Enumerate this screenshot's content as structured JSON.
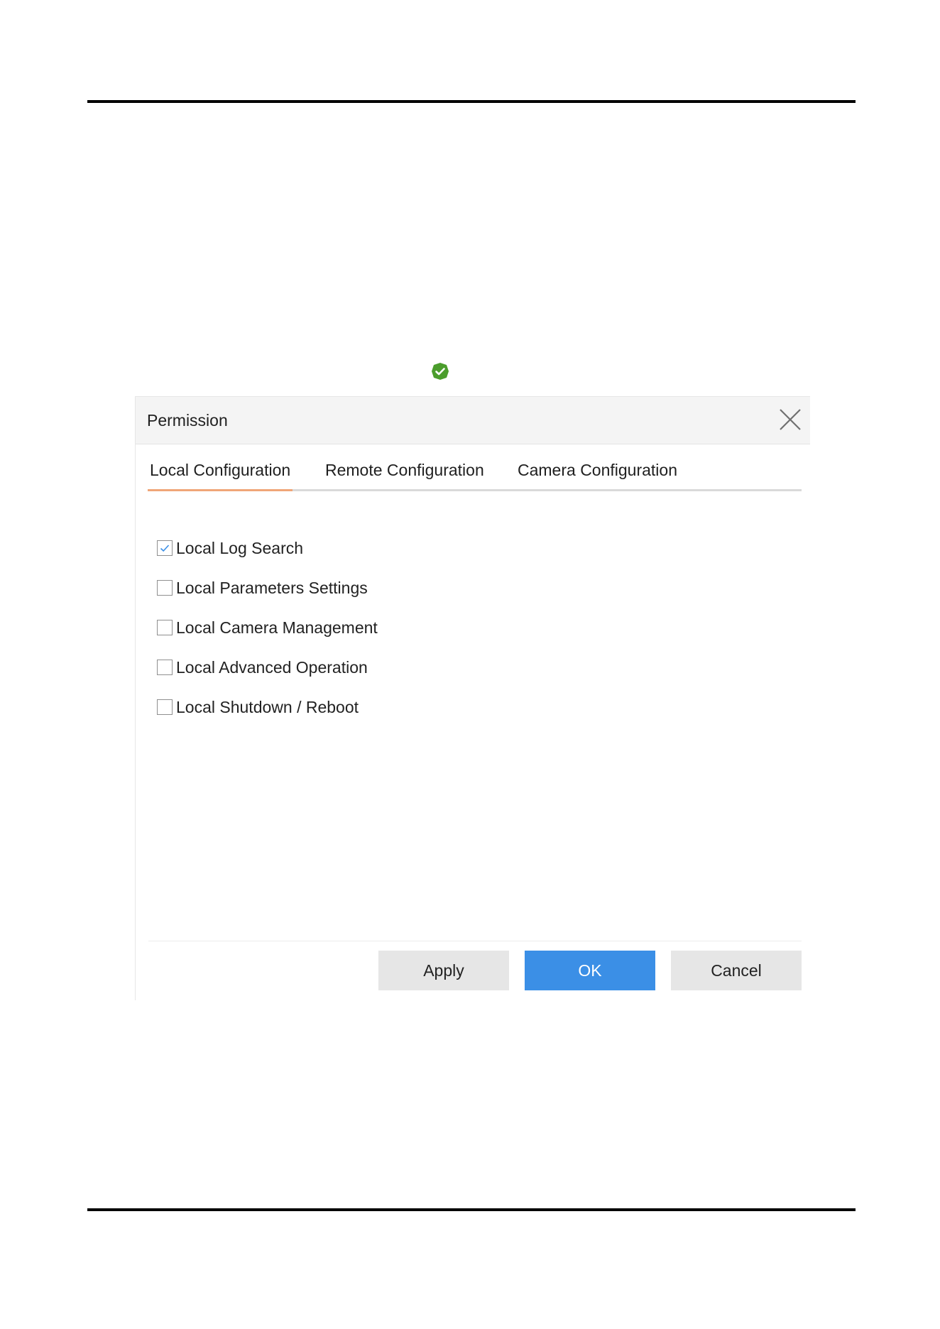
{
  "page": {
    "status_icon": "green-check-badge-icon"
  },
  "dialog": {
    "title": "Permission",
    "close_icon": "close-icon",
    "tabs": [
      {
        "label": "Local Configuration",
        "active": true
      },
      {
        "label": "Remote Configuration",
        "active": false
      },
      {
        "label": "Camera Configuration",
        "active": false
      }
    ],
    "permissions": [
      {
        "label": "Local Log Search",
        "checked": true
      },
      {
        "label": "Local Parameters Settings",
        "checked": false
      },
      {
        "label": "Local Camera Management",
        "checked": false
      },
      {
        "label": "Local Advanced Operation",
        "checked": false
      },
      {
        "label": "Local Shutdown / Reboot",
        "checked": false
      }
    ],
    "buttons": {
      "apply": "Apply",
      "ok": "OK",
      "cancel": "Cancel"
    }
  },
  "colors": {
    "accent_tab": "#f0a678",
    "primary_button": "#3b8fe6",
    "check_mark": "#3b8fe6",
    "status_green": "#4b9d2c"
  }
}
